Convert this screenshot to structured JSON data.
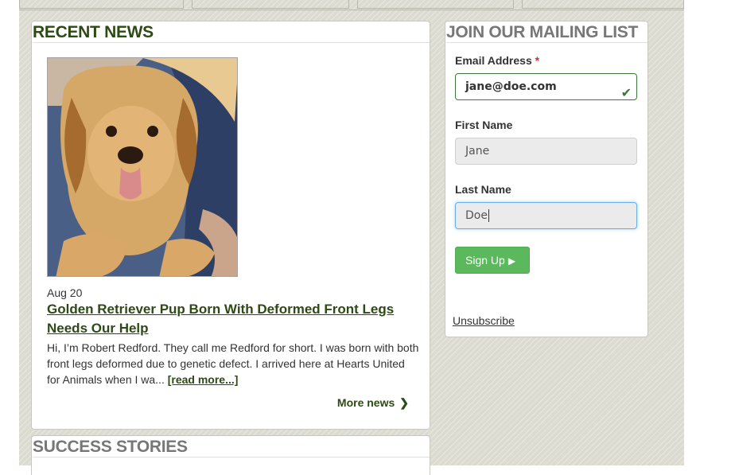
{
  "recent_news": {
    "title": "RECENT NEWS",
    "date": "Aug 20",
    "headline": "Golden Retriever Pup Born With Deformed Front Legs Needs Our Help",
    "excerpt": "Hi, I’m Robert Redford.  They call me Redford for short.  I was born with both front legs deformed due to genetic defect.  I arrived here at Hearts United for Animals when I wa... ",
    "read_more": "[read more...]",
    "more_news": "More news"
  },
  "mailing_list": {
    "title": "JOIN OUR MAILING LIST",
    "email_label": "Email Address",
    "required_mark": "*",
    "email_value": "jane@doe.com",
    "first_name_label": "First Name",
    "first_name_value": "Jane",
    "last_name_label": "Last Name",
    "last_name_value": "Doe",
    "signup_label": "Sign Up",
    "unsubscribe": "Unsubscribe"
  },
  "success_stories": {
    "title": "SUCCESS STORIES"
  },
  "colors": {
    "brand_green": "#2d4a15",
    "button_green": "#5cb85c",
    "valid_border": "#3c763d",
    "focus_border": "#66afe9"
  }
}
